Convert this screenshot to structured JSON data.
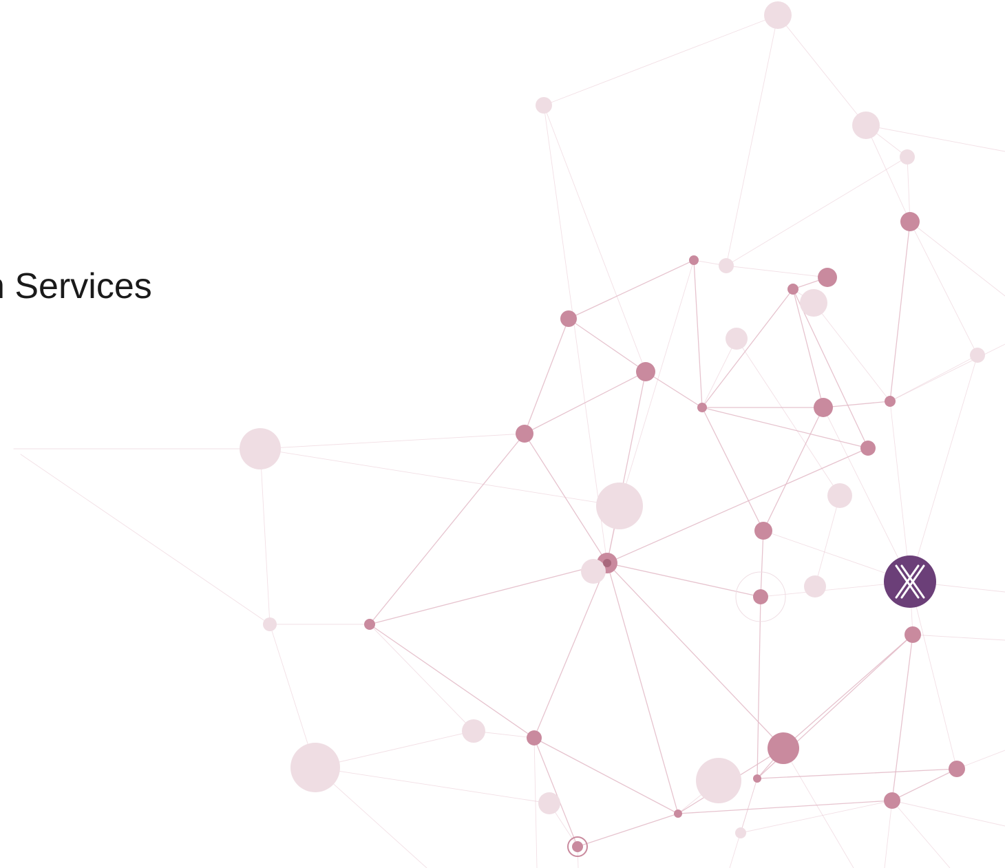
{
  "slide": {
    "title_fragment": "n Services"
  },
  "colors": {
    "background": "#ffffff",
    "text": "#1a1a1a",
    "node_strong": "#c98a9e",
    "node_soft": "#efdde3",
    "edge": "#e2b9c6",
    "logo_fill": "#6b3f78",
    "logo_mark": "#ffffff"
  },
  "icons": {
    "logo": "x-logo-icon"
  }
}
